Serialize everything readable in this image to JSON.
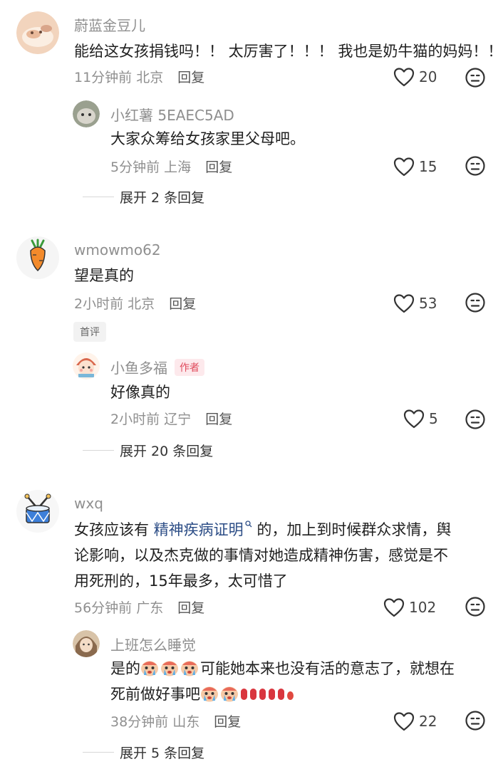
{
  "comments": [
    {
      "username": "蔚蓝金豆儿",
      "text": "能给这女孩捐钱吗！！ 太厉害了！！！ 我也是奶牛猫的妈妈！！",
      "time": "11分钟前",
      "location": "北京",
      "reply_label": "回复",
      "likes": "20",
      "replies": [
        {
          "username": "小红薯 5EAEC5AD",
          "text": "大家众筹给女孩家里父母吧。",
          "time": "5分钟前",
          "location": "上海",
          "reply_label": "回复",
          "likes": "15"
        }
      ],
      "expand_label": "展开 2 条回复"
    },
    {
      "username": "wmowmo62",
      "text": "望是真的",
      "time": "2小时前",
      "location": "北京",
      "reply_label": "回复",
      "likes": "53",
      "tag": "首评",
      "replies": [
        {
          "username": "小鱼多福",
          "author_tag": "作者",
          "text": "好像真的",
          "time": "2小时前",
          "location": "辽宁",
          "reply_label": "回复",
          "likes": "5"
        }
      ],
      "expand_label": "展开 20 条回复"
    },
    {
      "username": "wxq",
      "text_part1": "女孩应该有",
      "link_keyword": "精神疾病证明",
      "text_part2": "的，加上到时候群众求情，舆",
      "text_line2": "论影响，以及杰克做的事情对她造成精神伤害，感觉是不",
      "text_line3": "用死刑的，15年最多，太可惜了",
      "time": "56分钟前",
      "location": "广东",
      "reply_label": "回复",
      "likes": "102",
      "replies": [
        {
          "username": "上班怎么睡觉",
          "text_prefix": "是的",
          "text_mid": "可能她本来也没有活的意志了，就想在",
          "text_line2": "死前做好事吧",
          "time": "38分钟前",
          "location": "山东",
          "reply_label": "回复",
          "likes": "22"
        }
      ],
      "expand_label": "展开 5 条回复"
    }
  ],
  "colors": {
    "meta_gray": "#8f8f8f",
    "author_tag_bg": "#fde9ec",
    "author_tag_text": "#e04b5c",
    "link_blue": "#2c4d86"
  }
}
